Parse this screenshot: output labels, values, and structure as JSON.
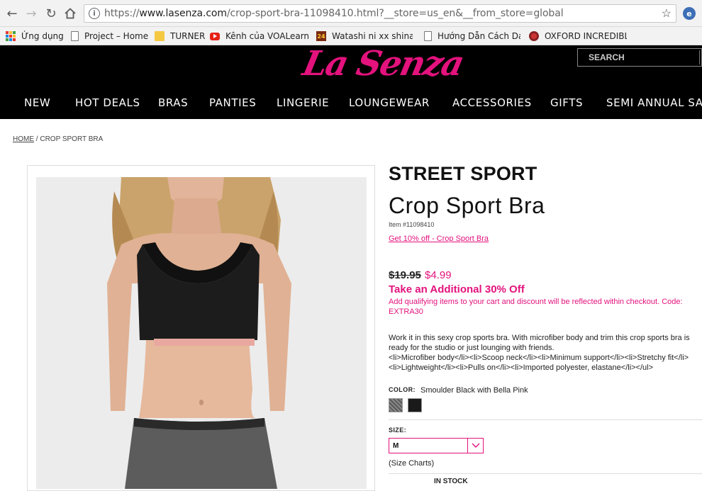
{
  "browser": {
    "url_prefix": "https://",
    "url_domain": "www.lasenza.com",
    "url_path": "/crop-sport-bra-11098410.html?__store=us_en&__from_store=global",
    "ext_label": "e"
  },
  "bookmarks": [
    {
      "label": "Ứng dụng",
      "icon": "apps-grid-icon"
    },
    {
      "label": "Project – Home",
      "icon": "page-icon"
    },
    {
      "label": "TURNER",
      "icon": "folder-icon"
    },
    {
      "label": "Kênh của VOALearnir",
      "icon": "youtube-icon"
    },
    {
      "label": "Watashi ni xx shinasa",
      "icon": "site-24-icon"
    },
    {
      "label": "Hướng Dẫn Cách Day",
      "icon": "page-icon"
    },
    {
      "label": "OXFORD INCREDIBLE",
      "icon": "oxford-icon"
    }
  ],
  "site": {
    "logo": "La Senza",
    "search_placeholder": "SEARCH",
    "nav": [
      "NEW",
      "HOT DEALS",
      "BRAS",
      "PANTIES",
      "LINGERIE",
      "LOUNGEWEAR",
      "ACCESSORIES",
      "GIFTS",
      "SEMI ANNUAL SAL"
    ]
  },
  "breadcrumb": {
    "home": "HOME",
    "separator": " / ",
    "current": "CROP SPORT BRA"
  },
  "product": {
    "brand": "STREET SPORT",
    "name": "Crop Sport Bra",
    "item_no": "Item #11098410",
    "promo_link": "Get 10% off - Crop Sport Bra",
    "price_was": "$19.95",
    "price_now": "$4.99",
    "promo_head": "Take an Additional 30% Off",
    "promo_text": "Add qualifying items to your cart and discount will be reflected within checkout. Code: EXTRA30",
    "description": "Work it in this sexy crop sports bra. With microfiber body and trim this crop sports bra is ready for the studio or just lounging with friends.",
    "description_raw": "<li>Microfiber body</li><li>Scoop neck</li><li>Minimum support</li><li>Stretchy fit</li><li>Lightweight</li><li>Pulls on</li><li>Imported polyester, elastane</li></ul>",
    "color_label": "COLOR:",
    "color_value": "Smoulder Black with Bella Pink",
    "swatches": [
      {
        "name": "heather-grey",
        "color": "#6e6e6e"
      },
      {
        "name": "black",
        "color": "#1a1a1a"
      }
    ],
    "size_label": "SIZE:",
    "size_value": "M",
    "size_charts": "(Size Charts)",
    "stock": "IN STOCK"
  },
  "colors": {
    "brand_pink": "#e3127d",
    "header_bg": "#000000"
  }
}
